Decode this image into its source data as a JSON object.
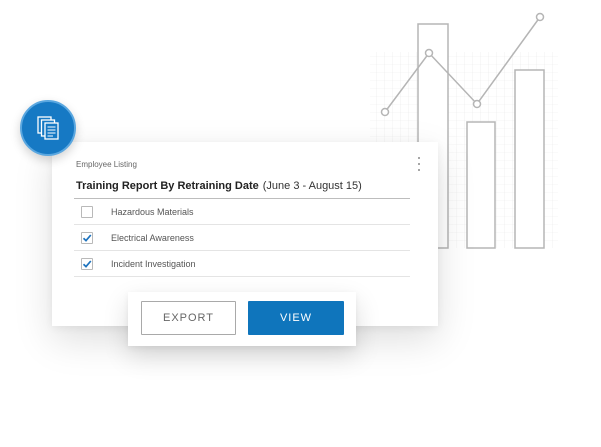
{
  "card": {
    "kicker": "Employee Listing",
    "title": "Training Report By Retraining Date",
    "date_range": "(June 3 - August 15)",
    "items": [
      {
        "label": "Hazardous Materials",
        "checked": false
      },
      {
        "label": "Electrical Awareness",
        "checked": true
      },
      {
        "label": "Incident Investigation",
        "checked": true
      }
    ]
  },
  "actions": {
    "export_label": "EXPORT",
    "view_label": "VIEW"
  },
  "icons": {
    "badge": "documents-icon",
    "menu": "kebab-menu-icon",
    "check": "checkmark-icon"
  },
  "colors": {
    "accent": "#0f75bc",
    "badge": "#1679c4",
    "check": "#1e73be"
  }
}
